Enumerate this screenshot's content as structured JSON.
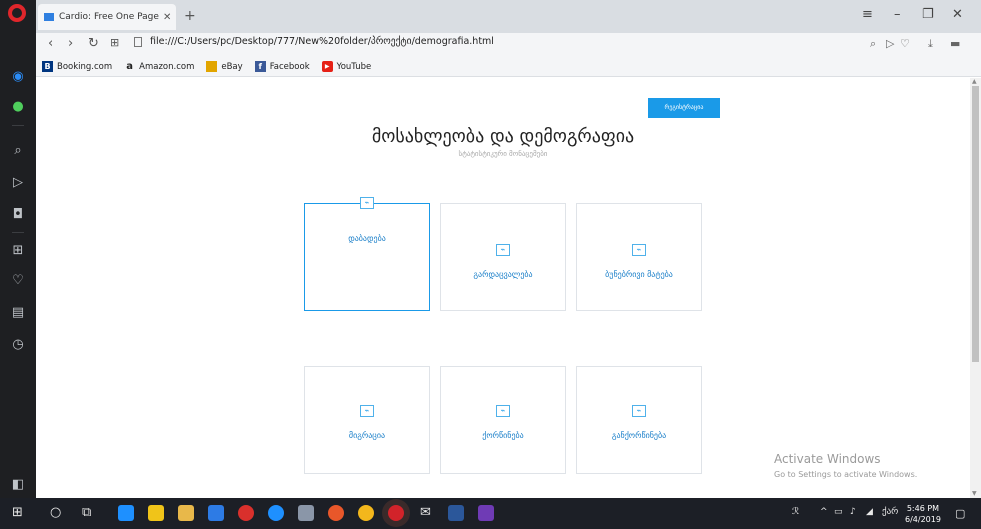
{
  "browser": {
    "tab_title": "Cardio: Free One Page Ten",
    "tab_close": "✕",
    "new_tab": "+",
    "url": "file:///C:/Users/pc/Desktop/777/New%20folder/პროექტი/demografia.html",
    "bookmarks": [
      {
        "label": "Booking.com",
        "color": "#003580",
        "glyph": "B"
      },
      {
        "label": "Amazon.com",
        "color": "#222222",
        "glyph": "a"
      },
      {
        "label": "eBay",
        "color": "#e2a500",
        "glyph": "🛍"
      },
      {
        "label": "Facebook",
        "color": "#3b5998",
        "glyph": "f"
      },
      {
        "label": "YouTube",
        "color": "#e62117",
        "glyph": "▶"
      }
    ]
  },
  "page": {
    "register_button": "რეგისტრაცია",
    "title": "მოსახლეობა და დემოგრაფია",
    "subtitle": "სტატისტიკური მონაცემები",
    "cards": [
      {
        "label": "დაბადება",
        "active": true
      },
      {
        "label": "გარდაცვალება",
        "active": false
      },
      {
        "label": "ბუნებრივი მატება",
        "active": false
      },
      {
        "label": "მიგრაცია",
        "active": false
      },
      {
        "label": "ქორწინება",
        "active": false
      },
      {
        "label": "განქორწინება",
        "active": false
      }
    ],
    "card_icon": "⌁"
  },
  "watermark": {
    "line1": "Activate Windows",
    "line2": "Go to Settings to activate Windows."
  },
  "taskbar": {
    "time": "5:46 PM",
    "date": "6/4/2019",
    "lang": "ქარ",
    "app_colors": [
      "#1e90ff",
      "#f0c419",
      "#2b579a",
      "#2d7be5",
      "#d9302c",
      "#1e90ff",
      "#e8572a",
      "#ff7139",
      "#f3b71c",
      "#d2232a",
      "#ffffff",
      "#2b579a",
      "#6f3bb5"
    ]
  }
}
